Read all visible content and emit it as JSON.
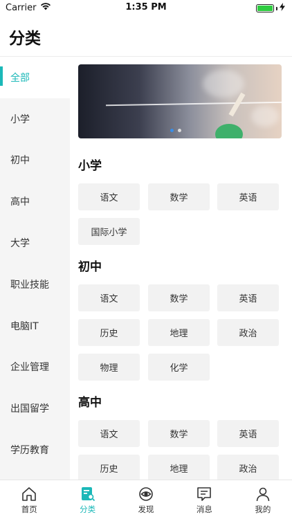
{
  "status": {
    "carrier": "Carrier",
    "time": "1:35 PM"
  },
  "page": {
    "title": "分类"
  },
  "sidebar": {
    "items": [
      {
        "label": "全部",
        "active": true
      },
      {
        "label": "小学"
      },
      {
        "label": "初中"
      },
      {
        "label": "高中"
      },
      {
        "label": "大学"
      },
      {
        "label": "职业技能"
      },
      {
        "label": "电脑IT"
      },
      {
        "label": "企业管理"
      },
      {
        "label": "出国留学"
      },
      {
        "label": "学历教育"
      }
    ]
  },
  "banner": {
    "page_count": 2,
    "current_page": 1
  },
  "sections": [
    {
      "title": "小学",
      "tags": [
        "语文",
        "数学",
        "英语",
        "国际小学"
      ]
    },
    {
      "title": "初中",
      "tags": [
        "语文",
        "数学",
        "英语",
        "历史",
        "地理",
        "政治",
        "物理",
        "化学"
      ]
    },
    {
      "title": "高中",
      "tags": [
        "语文",
        "数学",
        "英语",
        "历史",
        "地理",
        "政治"
      ]
    }
  ],
  "tabbar": {
    "tabs": [
      {
        "label": "首页",
        "icon": "home-icon"
      },
      {
        "label": "分类",
        "icon": "category-icon",
        "active": true
      },
      {
        "label": "发现",
        "icon": "eye-icon"
      },
      {
        "label": "消息",
        "icon": "message-icon"
      },
      {
        "label": "我的",
        "icon": "user-icon"
      }
    ]
  },
  "colors": {
    "accent": "#1bb8b8",
    "sidebar_bg": "#f5f5f5",
    "tag_bg": "#f2f2f2"
  }
}
